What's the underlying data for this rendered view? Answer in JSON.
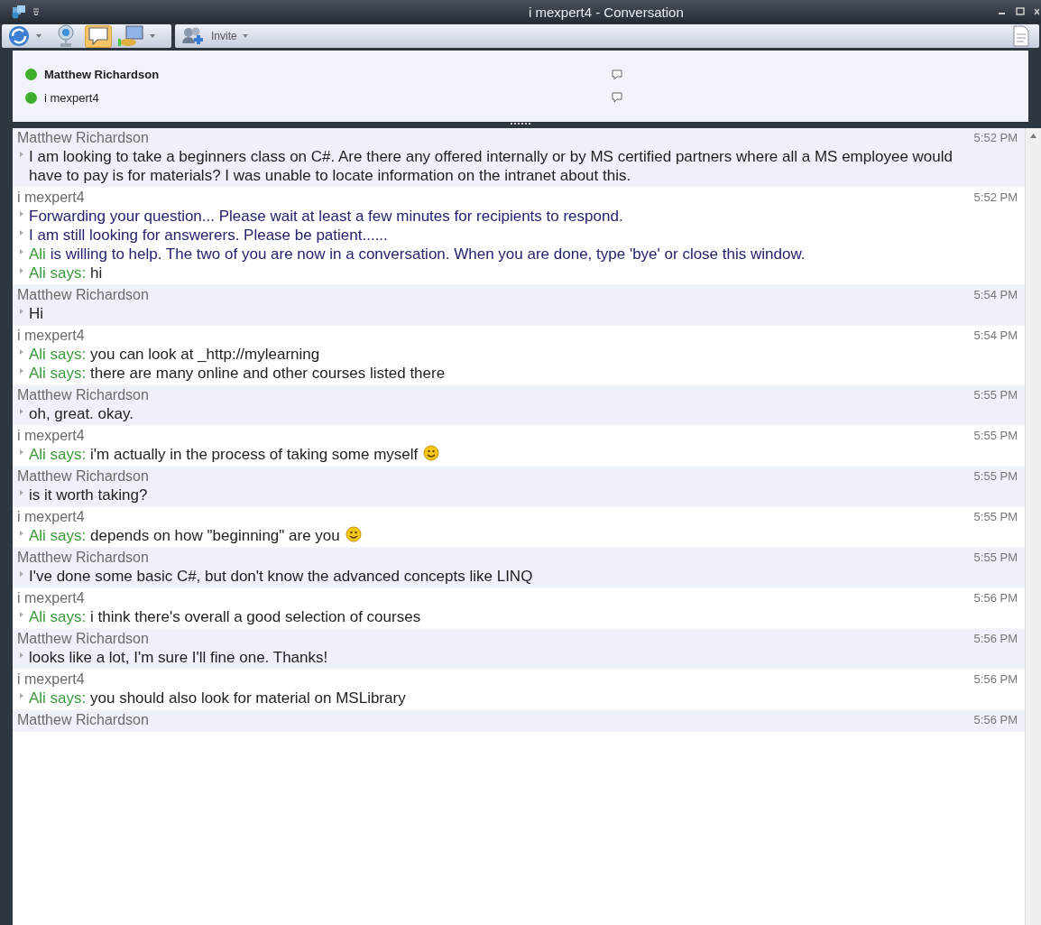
{
  "window": {
    "title": "i mexpert4 - Conversation"
  },
  "toolbar": {
    "invite": "Invite"
  },
  "participants": [
    {
      "name": "Matthew Richardson",
      "bold": true,
      "color": "#3fae2a"
    },
    {
      "name": "i mexpert4",
      "bold": false,
      "color": "#3fae2a"
    }
  ],
  "messages": [
    {
      "sender": "Matthew Richardson",
      "time": "5:52 PM",
      "shaded": true,
      "lines": [
        {
          "kind": "plain",
          "text": "I am looking to take a beginners class on C#.  Are there any offered internally or by MS certified partners where all a MS employee would have to pay is for materials?  I was unable to locate information on the intranet about this."
        }
      ]
    },
    {
      "sender": "i mexpert4",
      "time": "5:52 PM",
      "shaded": false,
      "lines": [
        {
          "kind": "system",
          "text": "Forwarding your question... Please wait at least a few minutes for recipients to respond."
        },
        {
          "kind": "system",
          "text": "I am still looking for answerers. Please be patient......"
        },
        {
          "kind": "system",
          "speaker": "Ali",
          "text": "is willing to help. The two of you are now in a conversation. When you are done, type 'bye' or close this window."
        },
        {
          "kind": "relay",
          "speaker": "Ali says:",
          "text": "hi"
        }
      ]
    },
    {
      "sender": "Matthew Richardson",
      "time": "5:54 PM",
      "shaded": true,
      "lines": [
        {
          "kind": "plain",
          "text": "Hi"
        }
      ]
    },
    {
      "sender": "i mexpert4",
      "time": "5:54 PM",
      "shaded": false,
      "lines": [
        {
          "kind": "relay",
          "speaker": "Ali says:",
          "text": "you can look at _http://mylearning"
        },
        {
          "kind": "relay",
          "speaker": "Ali says:",
          "text": "there are many online and other courses listed there"
        }
      ]
    },
    {
      "sender": "Matthew Richardson",
      "time": "5:55 PM",
      "shaded": true,
      "lines": [
        {
          "kind": "plain",
          "text": "oh, great. okay."
        }
      ]
    },
    {
      "sender": "i mexpert4",
      "time": "5:55 PM",
      "shaded": false,
      "lines": [
        {
          "kind": "relay",
          "speaker": "Ali says:",
          "text": "i'm actually in the process of taking some myself",
          "emoticon": true
        }
      ]
    },
    {
      "sender": "Matthew Richardson",
      "time": "5:55 PM",
      "shaded": true,
      "lines": [
        {
          "kind": "plain",
          "text": "is it worth taking?"
        }
      ]
    },
    {
      "sender": "i mexpert4",
      "time": "5:55 PM",
      "shaded": false,
      "lines": [
        {
          "kind": "relay",
          "speaker": "Ali says:",
          "text": "depends on how \"beginning\" are you",
          "emoticon": true
        }
      ]
    },
    {
      "sender": "Matthew Richardson",
      "time": "5:55 PM",
      "shaded": true,
      "lines": [
        {
          "kind": "plain",
          "text": "I've done some basic C#, but don't know the advanced concepts like LINQ"
        }
      ]
    },
    {
      "sender": "i mexpert4",
      "time": "5:56 PM",
      "shaded": false,
      "lines": [
        {
          "kind": "relay",
          "speaker": "Ali says:",
          "text": "i think there's overall a good selection of courses"
        }
      ]
    },
    {
      "sender": "Matthew Richardson",
      "time": "5:56 PM",
      "shaded": true,
      "lines": [
        {
          "kind": "plain",
          "text": "looks like a lot, I'm sure I'll fine one. Thanks!"
        }
      ]
    },
    {
      "sender": "i mexpert4",
      "time": "5:56 PM",
      "shaded": false,
      "lines": [
        {
          "kind": "relay",
          "speaker": "Ali says:",
          "text": "you should also look for material on MSLibrary"
        }
      ]
    },
    {
      "sender": "Matthew Richardson",
      "time": "5:56 PM",
      "shaded": true
    }
  ]
}
